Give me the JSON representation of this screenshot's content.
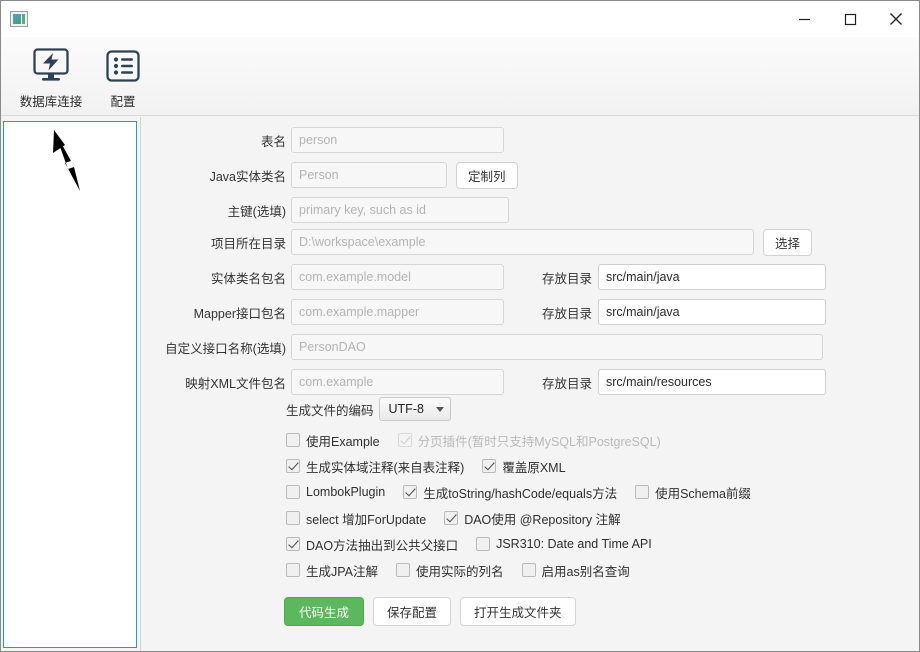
{
  "window": {
    "title": "",
    "icon": "app-icon",
    "controls": {
      "minimize": "—",
      "maximize": "□",
      "close": "✕"
    }
  },
  "toolbar": {
    "items": [
      {
        "label": "数据库连接",
        "icon": "database-connection-icon"
      },
      {
        "label": "配置",
        "icon": "settings-list-icon"
      }
    ]
  },
  "form": {
    "rows": [
      {
        "label": "表名",
        "placeholder": "person",
        "value": ""
      },
      {
        "label": "Java实体类名",
        "placeholder": "Person",
        "value": "",
        "button": "定制列"
      },
      {
        "label": "主键(选填)",
        "placeholder": "primary key, such as id",
        "value": ""
      },
      {
        "label": "项目所在目录",
        "placeholder": "D:\\workspace\\example",
        "value": "",
        "button": "选择"
      },
      {
        "label": "实体类名包名",
        "placeholder": "com.example.model",
        "value": "",
        "label2": "存放目录",
        "value2": "src/main/java"
      },
      {
        "label": "Mapper接口包名",
        "placeholder": "com.example.mapper",
        "value": "",
        "label2": "存放目录",
        "value2": "src/main/java"
      },
      {
        "label": "自定义接口名称(选填)",
        "placeholder": "PersonDAO",
        "value": ""
      },
      {
        "label": "映射XML文件包名",
        "placeholder": "com.example",
        "value": "",
        "label2": "存放目录",
        "value2": "src/main/resources"
      }
    ]
  },
  "encoding": {
    "label": "生成文件的编码",
    "value": "UTF-8"
  },
  "options": [
    [
      {
        "label": "使用Example",
        "checked": false,
        "disabled": false
      },
      {
        "label": "分页插件(暂时只支持MySQL和PostgreSQL)",
        "checked": true,
        "disabled": true
      }
    ],
    [
      {
        "label": "生成实体域注释(来自表注释)",
        "checked": true,
        "disabled": false
      },
      {
        "label": "覆盖原XML",
        "checked": true,
        "disabled": false
      }
    ],
    [
      {
        "label": "LombokPlugin",
        "checked": false,
        "disabled": false
      },
      {
        "label": "生成toString/hashCode/equals方法",
        "checked": true,
        "disabled": false
      },
      {
        "label": "使用Schema前缀",
        "checked": false,
        "disabled": false
      }
    ],
    [
      {
        "label": "select 增加ForUpdate",
        "checked": false,
        "disabled": false
      },
      {
        "label": "DAO使用 @Repository 注解",
        "checked": true,
        "disabled": false
      }
    ],
    [
      {
        "label": "DAO方法抽出到公共父接口",
        "checked": true,
        "disabled": false
      },
      {
        "label": "JSR310: Date and Time API",
        "checked": false,
        "disabled": false
      }
    ],
    [
      {
        "label": "生成JPA注解",
        "checked": false,
        "disabled": false
      },
      {
        "label": "使用实际的列名",
        "checked": false,
        "disabled": false
      },
      {
        "label": "启用as别名查询",
        "checked": false,
        "disabled": false
      }
    ]
  ],
  "actions": {
    "generate": "代码生成",
    "save": "保存配置",
    "open_folder": "打开生成文件夹"
  },
  "colors": {
    "primary": "#5cb85c",
    "panel_border": "#1b9ad6",
    "icon": "#2e4257"
  }
}
